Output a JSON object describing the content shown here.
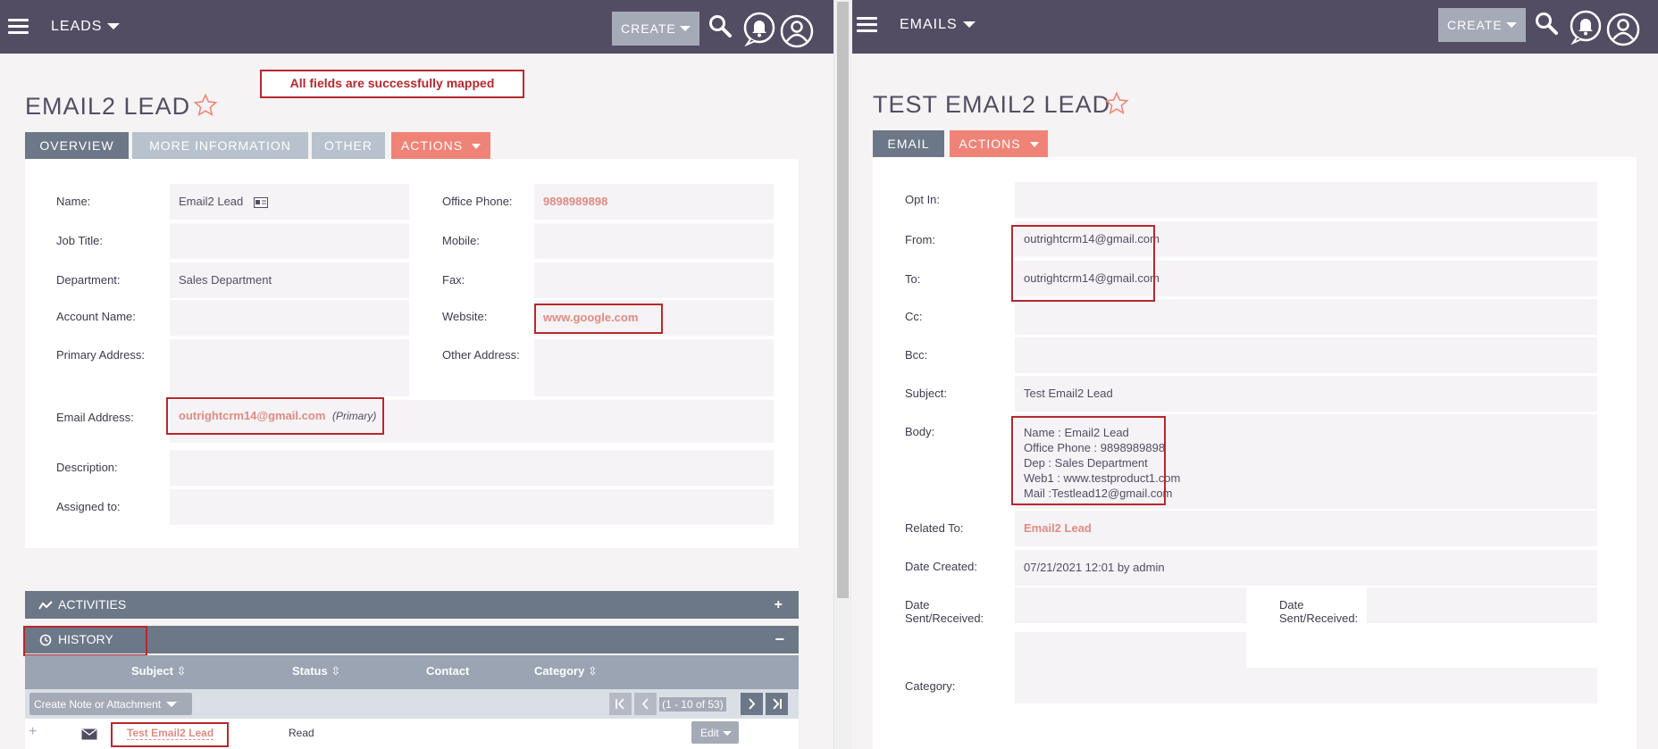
{
  "left": {
    "topbar": {
      "module": "LEADS",
      "create_label": "CREATE"
    },
    "status_message": "All fields are successfully mapped",
    "title": "EMAIL2 LEAD",
    "tabs": [
      {
        "label": "OVERVIEW"
      },
      {
        "label": "MORE INFORMATION"
      },
      {
        "label": "OTHER"
      },
      {
        "label": "ACTIONS"
      }
    ],
    "fields": {
      "name": {
        "label": "Name:",
        "value": "Email2 Lead"
      },
      "job_title": {
        "label": "Job Title:",
        "value": ""
      },
      "department": {
        "label": "Department:",
        "value": "Sales Department"
      },
      "account_name": {
        "label": "Account Name:",
        "value": ""
      },
      "primary_address": {
        "label": "Primary Address:",
        "value": ""
      },
      "email_address": {
        "label": "Email Address:",
        "value": "outrightcrm14@gmail.com",
        "suffix": "(Primary)"
      },
      "description": {
        "label": "Description:",
        "value": ""
      },
      "assigned_to": {
        "label": "Assigned to:",
        "value": ""
      },
      "office_phone": {
        "label": "Office Phone:",
        "value": "9898989898"
      },
      "mobile": {
        "label": "Mobile:",
        "value": ""
      },
      "fax": {
        "label": "Fax:",
        "value": ""
      },
      "website": {
        "label": "Website:",
        "value": "www.google.com"
      },
      "other_address": {
        "label": "Other Address:",
        "value": ""
      }
    },
    "subpanels": {
      "activities": {
        "label": "ACTIVITIES",
        "toggle": "+"
      },
      "history": {
        "label": "HISTORY",
        "toggle": "−",
        "columns": [
          "Subject",
          "Status",
          "Contact",
          "Category"
        ],
        "create_label": "Create Note or Attachment",
        "pagination": "(1 - 10 of 53)",
        "rows": [
          {
            "subject": "Test Email2 Lead",
            "status": "Read",
            "edit_label": "Edit"
          }
        ]
      }
    }
  },
  "right": {
    "topbar": {
      "module": "EMAILS",
      "create_label": "CREATE"
    },
    "title": "TEST EMAIL2 LEAD",
    "tabs": [
      {
        "label": "EMAIL"
      },
      {
        "label": "ACTIONS"
      }
    ],
    "fields": {
      "opt_in": {
        "label": "Opt In:",
        "value": ""
      },
      "from": {
        "label": "From:",
        "value": "outrightcrm14@gmail.com"
      },
      "to": {
        "label": "To:",
        "value": "outrightcrm14@gmail.com"
      },
      "cc": {
        "label": "Cc:",
        "value": ""
      },
      "bcc": {
        "label": "Bcc:",
        "value": ""
      },
      "subject": {
        "label": "Subject:",
        "value": "Test Email2 Lead"
      },
      "body": {
        "label": "Body:",
        "lines": [
          "Name : Email2 Lead",
          "Office Phone : 9898989898",
          "Dep : Sales Department",
          "Web1 : www.testproduct1.com",
          "Mail :Testlead12@gmail.com"
        ]
      },
      "related_to": {
        "label": "Related To:",
        "value": "Email2 Lead"
      },
      "date_created": {
        "label": "Date Created:",
        "value": "07/21/2021 12:01 by admin"
      },
      "date_sent_1": {
        "label_line1": "Date",
        "label_line2": "Sent/Received:",
        "value": ""
      },
      "date_sent_2": {
        "label_line1": "Date",
        "label_line2": "Sent/Received:",
        "value": ""
      },
      "category": {
        "label": "Category:",
        "value": ""
      }
    }
  },
  "colors": {
    "topbar": "#534d64",
    "tab_active": "#6c7887",
    "tab_inactive": "#b7c2cd",
    "actions": "#f08377",
    "link": "#e08b84",
    "highlight_box": "#b7282e",
    "field_bg": "#f5f3f5"
  },
  "icons": {
    "menu": "hamburger-icon",
    "search": "search-icon",
    "notifications": "bell-icon",
    "profile": "user-icon",
    "favorite": "star-icon"
  }
}
